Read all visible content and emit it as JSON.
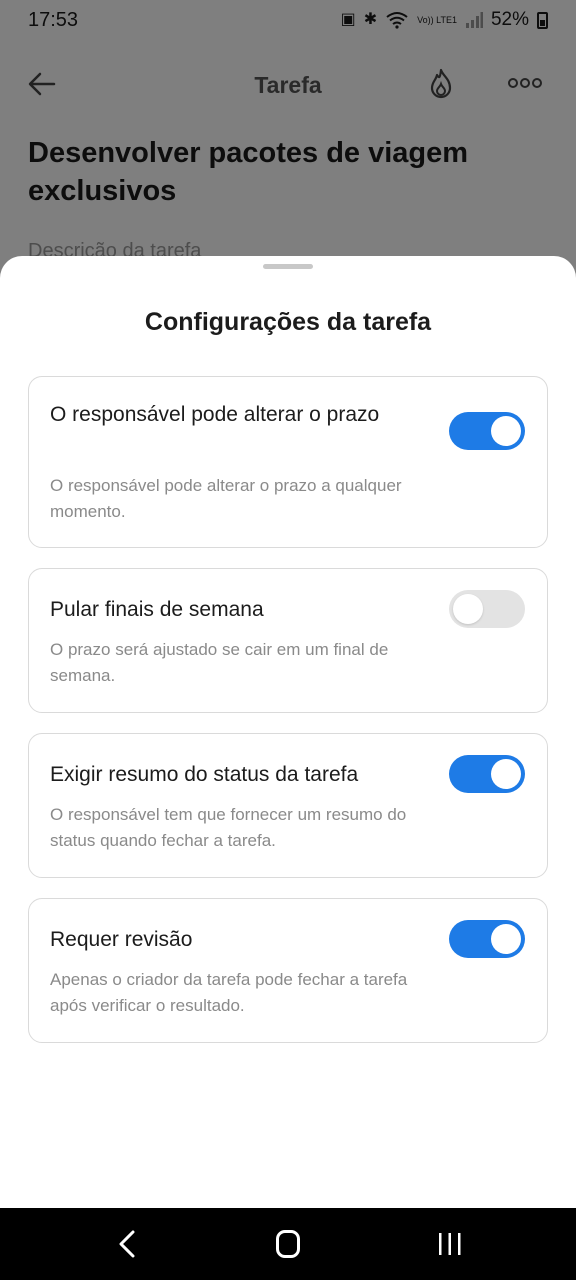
{
  "status_bar": {
    "time": "17:53",
    "network_label": "Vo)) LTE1",
    "battery": "52%"
  },
  "app_bar": {
    "title": "Tarefa",
    "icons": [
      "back-arrow-icon",
      "fire-icon",
      "more-icon"
    ]
  },
  "task": {
    "title": "Desenvolver pacotes de viagem exclusivos",
    "description_placeholder": "Descrição da tarefa"
  },
  "sheet": {
    "title": "Configurações da tarefa",
    "settings": [
      {
        "title": "O responsável pode alterar o prazo",
        "description": "O responsável pode alterar o prazo a qualquer momento.",
        "enabled": true
      },
      {
        "title": "Pular finais de semana",
        "description": "O prazo será ajustado se cair em um final de semana.",
        "enabled": false
      },
      {
        "title": "Exigir resumo do status da tarefa",
        "description": "O responsável tem que fornecer um resumo do status quando fechar a tarefa.",
        "enabled": true
      },
      {
        "title": "Requer revisão",
        "description": "Apenas o criador da tarefa pode fechar a tarefa após verificar o resultado.",
        "enabled": true
      }
    ]
  },
  "colors": {
    "toggle_on": "#1e7be6",
    "toggle_off": "#e3e3e3"
  }
}
